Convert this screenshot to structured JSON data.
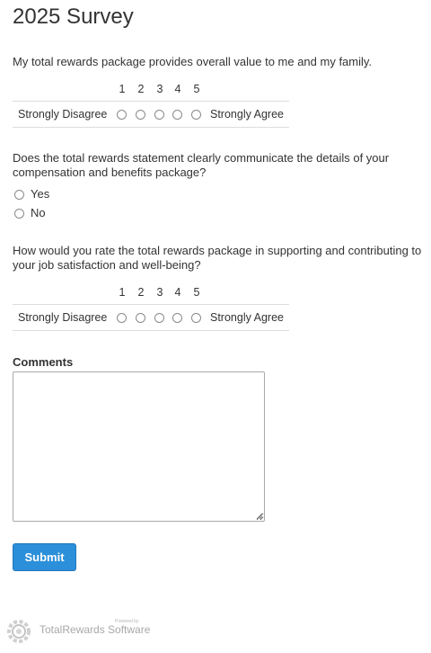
{
  "survey": {
    "title": "2025 Survey"
  },
  "questions": [
    {
      "text": "My total rewards package provides overall value to me and my family.",
      "scale_numbers": [
        "1",
        "2",
        "3",
        "4",
        "5"
      ],
      "low_label": "Strongly Disagree",
      "high_label": "Strongly Agree"
    },
    {
      "text": "Does the total rewards statement clearly communicate the details of your compensation and benefits package?",
      "options": [
        "Yes",
        "No"
      ]
    },
    {
      "text": "How would you rate the total rewards package in supporting and contributing to your job satisfaction and well-being?",
      "scale_numbers": [
        "1",
        "2",
        "3",
        "4",
        "5"
      ],
      "low_label": "Strongly Disagree",
      "high_label": "Strongly Agree"
    }
  ],
  "comments": {
    "label": "Comments",
    "value": ""
  },
  "submit": {
    "label": "Submit"
  },
  "footer": {
    "powered_by": "Powered by",
    "brand": "TotalRewards Software",
    "logo_icon": "gear-logo-icon"
  },
  "colors": {
    "accent": "#2b8fd9",
    "text": "#333333",
    "divider": "#dddddd",
    "brand_gray": "#a8a8a8"
  }
}
